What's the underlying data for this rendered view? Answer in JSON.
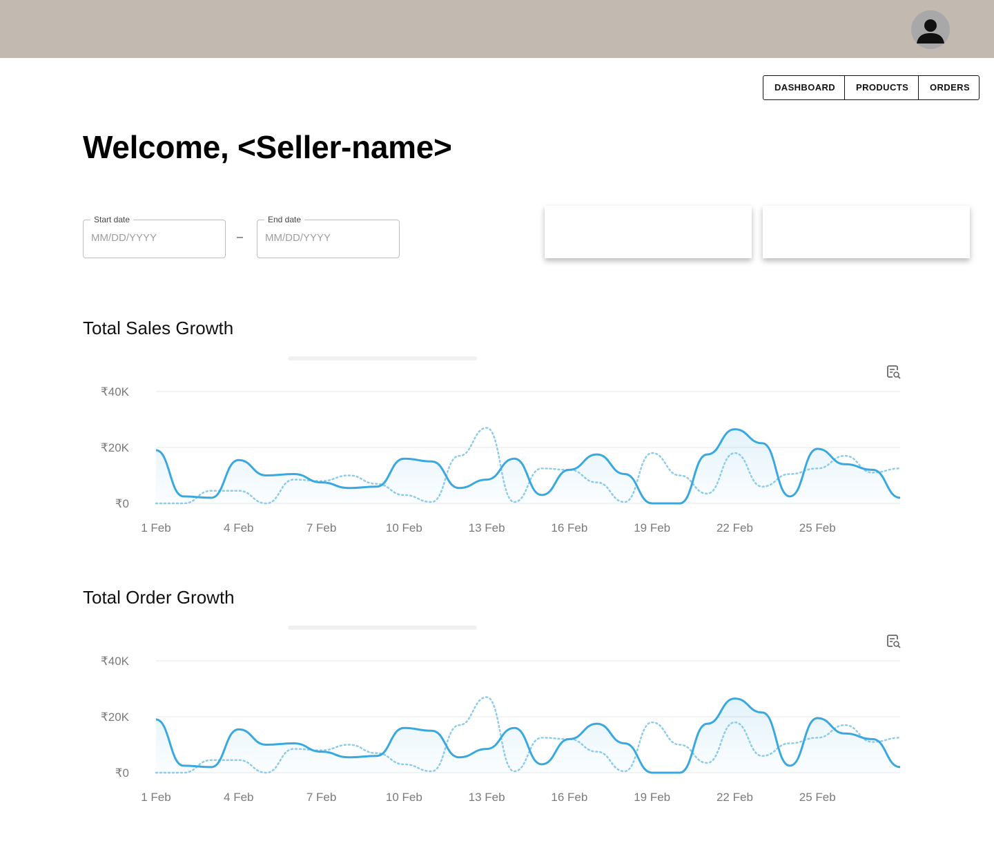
{
  "header": {
    "avatar_icon": "user-avatar-icon"
  },
  "nav": {
    "dashboard": "DASHBOARD",
    "products": "PRODUCTS",
    "orders": "ORDERS"
  },
  "welcome": {
    "title": "Welcome, <Seller-name>"
  },
  "date_range": {
    "start": {
      "label": "Start date",
      "placeholder": "MM/DD/YYYY"
    },
    "separator": "–",
    "end": {
      "label": "End date",
      "placeholder": "MM/DD/YYYY"
    }
  },
  "sections": {
    "sales": {
      "title": "Total Sales Growth"
    },
    "orders": {
      "title": "Total Order Growth"
    }
  },
  "colors": {
    "series": "#3aa8e0",
    "series_light": "#8ccbea",
    "grid": "#ececec",
    "axis_text": "#7a7a7a",
    "header_bg": "#c2bab0"
  },
  "chart_data": [
    {
      "type": "area",
      "title": "",
      "x": [
        "1 Feb",
        "2 Feb",
        "3 Feb",
        "4 Feb",
        "5 Feb",
        "6 Feb",
        "7 Feb",
        "8 Feb",
        "9 Feb",
        "10 Feb",
        "11 Feb",
        "12 Feb",
        "13 Feb",
        "14 Feb",
        "15 Feb",
        "16 Feb",
        "17 Feb",
        "18 Feb",
        "19 Feb",
        "20 Feb",
        "21 Feb",
        "22 Feb",
        "23 Feb",
        "24 Feb",
        "25 Feb",
        "26 Feb",
        "27 Feb",
        "28 Feb"
      ],
      "xticks": [
        "1 Feb",
        "4 Feb",
        "7 Feb",
        "10 Feb",
        "13 Feb",
        "16 Feb",
        "19 Feb",
        "22 Feb",
        "25 Feb"
      ],
      "yticks": [
        "₹0",
        "₹20K",
        "₹40K"
      ],
      "ylim": [
        0,
        40000
      ],
      "grid": true,
      "series": [
        {
          "style": "solid",
          "values": [
            19000,
            2500,
            2000,
            15500,
            10000,
            10500,
            7500,
            5500,
            6000,
            16000,
            15000,
            5500,
            8500,
            16000,
            3000,
            12000,
            17500,
            10500,
            0,
            0,
            17500,
            26500,
            21500,
            2500,
            19500,
            14000,
            12000,
            2000
          ]
        },
        {
          "style": "dotted",
          "values": [
            0,
            0,
            4500,
            4500,
            0,
            8500,
            8000,
            10000,
            7000,
            3000,
            500,
            17000,
            27000,
            500,
            12500,
            12000,
            7500,
            500,
            18000,
            10000,
            3500,
            18000,
            6000,
            10500,
            12500,
            17000,
            11000,
            12500
          ]
        }
      ]
    },
    {
      "type": "area",
      "title": "",
      "x": [
        "1 Feb",
        "2 Feb",
        "3 Feb",
        "4 Feb",
        "5 Feb",
        "6 Feb",
        "7 Feb",
        "8 Feb",
        "9 Feb",
        "10 Feb",
        "11 Feb",
        "12 Feb",
        "13 Feb",
        "14 Feb",
        "15 Feb",
        "16 Feb",
        "17 Feb",
        "18 Feb",
        "19 Feb",
        "20 Feb",
        "21 Feb",
        "22 Feb",
        "23 Feb",
        "24 Feb",
        "25 Feb",
        "26 Feb",
        "27 Feb",
        "28 Feb"
      ],
      "xticks": [
        "1 Feb",
        "4 Feb",
        "7 Feb",
        "10 Feb",
        "13 Feb",
        "16 Feb",
        "19 Feb",
        "22 Feb",
        "25 Feb"
      ],
      "yticks": [
        "₹0",
        "₹20K",
        "₹40K"
      ],
      "ylim": [
        0,
        40000
      ],
      "grid": true,
      "series": [
        {
          "style": "solid",
          "values": [
            19000,
            2500,
            2000,
            15500,
            10000,
            10500,
            7500,
            5500,
            6000,
            16000,
            15000,
            5500,
            8500,
            16000,
            3000,
            12000,
            17500,
            10500,
            0,
            0,
            17500,
            26500,
            21500,
            2500,
            19500,
            14000,
            12000,
            2000
          ]
        },
        {
          "style": "dotted",
          "values": [
            0,
            0,
            4500,
            4500,
            0,
            8500,
            8000,
            10000,
            7000,
            3000,
            500,
            17000,
            27000,
            500,
            12500,
            12000,
            7500,
            500,
            18000,
            10000,
            3500,
            18000,
            6000,
            10500,
            12500,
            17000,
            11000,
            12500
          ]
        }
      ]
    }
  ]
}
